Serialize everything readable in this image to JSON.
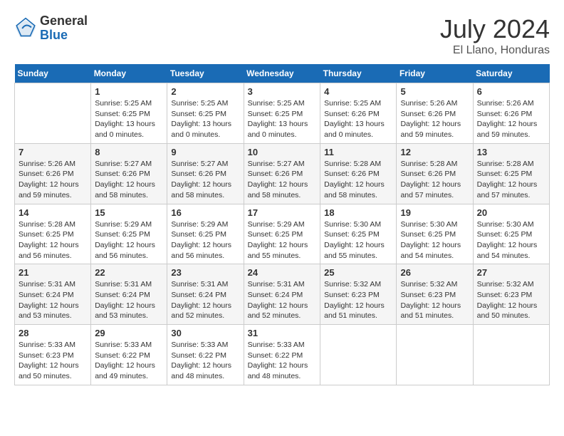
{
  "header": {
    "logo_general": "General",
    "logo_blue": "Blue",
    "month_year": "July 2024",
    "location": "El Llano, Honduras"
  },
  "days_of_week": [
    "Sunday",
    "Monday",
    "Tuesday",
    "Wednesday",
    "Thursday",
    "Friday",
    "Saturday"
  ],
  "weeks": [
    [
      {
        "day": "",
        "sunrise": "",
        "sunset": "",
        "daylight": ""
      },
      {
        "day": "1",
        "sunrise": "Sunrise: 5:25 AM",
        "sunset": "Sunset: 6:25 PM",
        "daylight": "Daylight: 13 hours and 0 minutes."
      },
      {
        "day": "2",
        "sunrise": "Sunrise: 5:25 AM",
        "sunset": "Sunset: 6:25 PM",
        "daylight": "Daylight: 13 hours and 0 minutes."
      },
      {
        "day": "3",
        "sunrise": "Sunrise: 5:25 AM",
        "sunset": "Sunset: 6:25 PM",
        "daylight": "Daylight: 13 hours and 0 minutes."
      },
      {
        "day": "4",
        "sunrise": "Sunrise: 5:25 AM",
        "sunset": "Sunset: 6:26 PM",
        "daylight": "Daylight: 13 hours and 0 minutes."
      },
      {
        "day": "5",
        "sunrise": "Sunrise: 5:26 AM",
        "sunset": "Sunset: 6:26 PM",
        "daylight": "Daylight: 12 hours and 59 minutes."
      },
      {
        "day": "6",
        "sunrise": "Sunrise: 5:26 AM",
        "sunset": "Sunset: 6:26 PM",
        "daylight": "Daylight: 12 hours and 59 minutes."
      }
    ],
    [
      {
        "day": "7",
        "sunrise": "Sunrise: 5:26 AM",
        "sunset": "Sunset: 6:26 PM",
        "daylight": "Daylight: 12 hours and 59 minutes."
      },
      {
        "day": "8",
        "sunrise": "Sunrise: 5:27 AM",
        "sunset": "Sunset: 6:26 PM",
        "daylight": "Daylight: 12 hours and 58 minutes."
      },
      {
        "day": "9",
        "sunrise": "Sunrise: 5:27 AM",
        "sunset": "Sunset: 6:26 PM",
        "daylight": "Daylight: 12 hours and 58 minutes."
      },
      {
        "day": "10",
        "sunrise": "Sunrise: 5:27 AM",
        "sunset": "Sunset: 6:26 PM",
        "daylight": "Daylight: 12 hours and 58 minutes."
      },
      {
        "day": "11",
        "sunrise": "Sunrise: 5:28 AM",
        "sunset": "Sunset: 6:26 PM",
        "daylight": "Daylight: 12 hours and 58 minutes."
      },
      {
        "day": "12",
        "sunrise": "Sunrise: 5:28 AM",
        "sunset": "Sunset: 6:26 PM",
        "daylight": "Daylight: 12 hours and 57 minutes."
      },
      {
        "day": "13",
        "sunrise": "Sunrise: 5:28 AM",
        "sunset": "Sunset: 6:25 PM",
        "daylight": "Daylight: 12 hours and 57 minutes."
      }
    ],
    [
      {
        "day": "14",
        "sunrise": "Sunrise: 5:28 AM",
        "sunset": "Sunset: 6:25 PM",
        "daylight": "Daylight: 12 hours and 56 minutes."
      },
      {
        "day": "15",
        "sunrise": "Sunrise: 5:29 AM",
        "sunset": "Sunset: 6:25 PM",
        "daylight": "Daylight: 12 hours and 56 minutes."
      },
      {
        "day": "16",
        "sunrise": "Sunrise: 5:29 AM",
        "sunset": "Sunset: 6:25 PM",
        "daylight": "Daylight: 12 hours and 56 minutes."
      },
      {
        "day": "17",
        "sunrise": "Sunrise: 5:29 AM",
        "sunset": "Sunset: 6:25 PM",
        "daylight": "Daylight: 12 hours and 55 minutes."
      },
      {
        "day": "18",
        "sunrise": "Sunrise: 5:30 AM",
        "sunset": "Sunset: 6:25 PM",
        "daylight": "Daylight: 12 hours and 55 minutes."
      },
      {
        "day": "19",
        "sunrise": "Sunrise: 5:30 AM",
        "sunset": "Sunset: 6:25 PM",
        "daylight": "Daylight: 12 hours and 54 minutes."
      },
      {
        "day": "20",
        "sunrise": "Sunrise: 5:30 AM",
        "sunset": "Sunset: 6:25 PM",
        "daylight": "Daylight: 12 hours and 54 minutes."
      }
    ],
    [
      {
        "day": "21",
        "sunrise": "Sunrise: 5:31 AM",
        "sunset": "Sunset: 6:24 PM",
        "daylight": "Daylight: 12 hours and 53 minutes."
      },
      {
        "day": "22",
        "sunrise": "Sunrise: 5:31 AM",
        "sunset": "Sunset: 6:24 PM",
        "daylight": "Daylight: 12 hours and 53 minutes."
      },
      {
        "day": "23",
        "sunrise": "Sunrise: 5:31 AM",
        "sunset": "Sunset: 6:24 PM",
        "daylight": "Daylight: 12 hours and 52 minutes."
      },
      {
        "day": "24",
        "sunrise": "Sunrise: 5:31 AM",
        "sunset": "Sunset: 6:24 PM",
        "daylight": "Daylight: 12 hours and 52 minutes."
      },
      {
        "day": "25",
        "sunrise": "Sunrise: 5:32 AM",
        "sunset": "Sunset: 6:23 PM",
        "daylight": "Daylight: 12 hours and 51 minutes."
      },
      {
        "day": "26",
        "sunrise": "Sunrise: 5:32 AM",
        "sunset": "Sunset: 6:23 PM",
        "daylight": "Daylight: 12 hours and 51 minutes."
      },
      {
        "day": "27",
        "sunrise": "Sunrise: 5:32 AM",
        "sunset": "Sunset: 6:23 PM",
        "daylight": "Daylight: 12 hours and 50 minutes."
      }
    ],
    [
      {
        "day": "28",
        "sunrise": "Sunrise: 5:33 AM",
        "sunset": "Sunset: 6:23 PM",
        "daylight": "Daylight: 12 hours and 50 minutes."
      },
      {
        "day": "29",
        "sunrise": "Sunrise: 5:33 AM",
        "sunset": "Sunset: 6:22 PM",
        "daylight": "Daylight: 12 hours and 49 minutes."
      },
      {
        "day": "30",
        "sunrise": "Sunrise: 5:33 AM",
        "sunset": "Sunset: 6:22 PM",
        "daylight": "Daylight: 12 hours and 48 minutes."
      },
      {
        "day": "31",
        "sunrise": "Sunrise: 5:33 AM",
        "sunset": "Sunset: 6:22 PM",
        "daylight": "Daylight: 12 hours and 48 minutes."
      },
      {
        "day": "",
        "sunrise": "",
        "sunset": "",
        "daylight": ""
      },
      {
        "day": "",
        "sunrise": "",
        "sunset": "",
        "daylight": ""
      },
      {
        "day": "",
        "sunrise": "",
        "sunset": "",
        "daylight": ""
      }
    ]
  ]
}
